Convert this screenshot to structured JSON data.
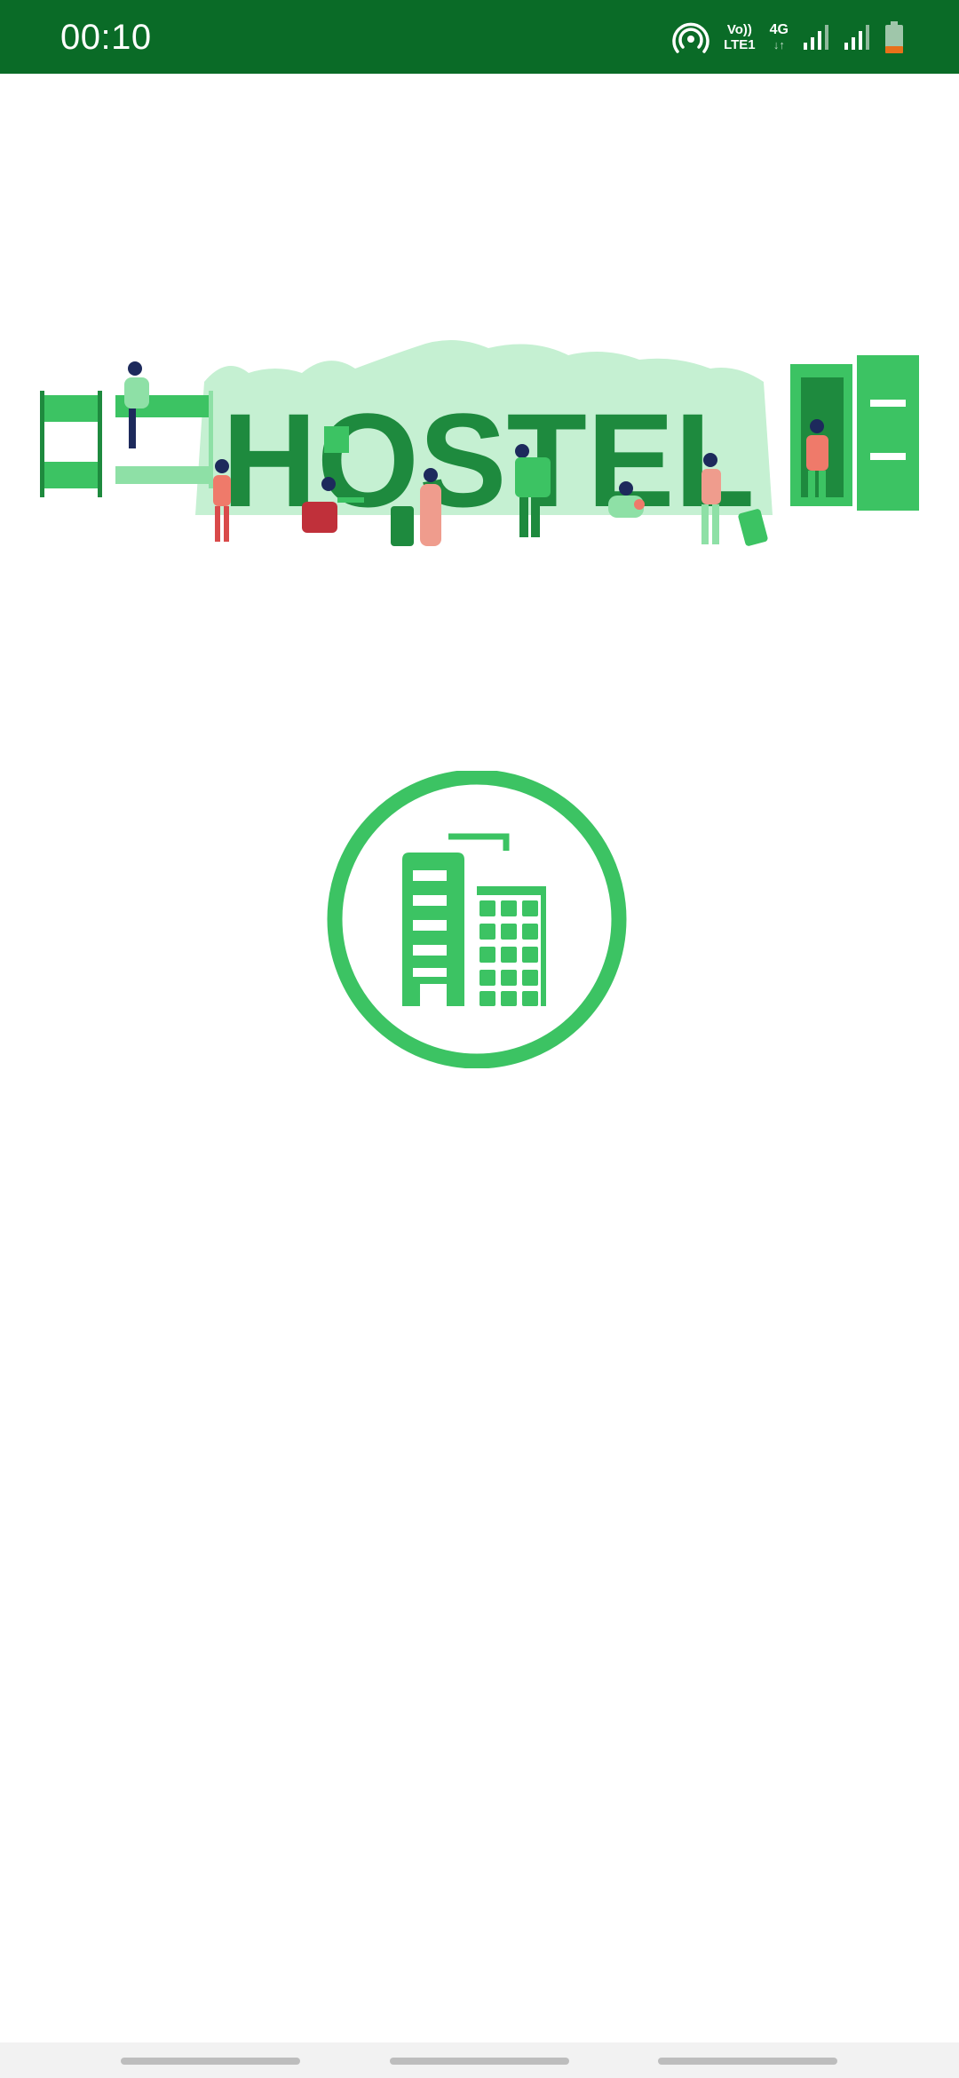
{
  "status_bar": {
    "time": "00:10",
    "icons": [
      "hotspot-icon",
      "volte-icon",
      "4g-icon",
      "signal-icon",
      "signal-icon",
      "battery-icon"
    ],
    "volte_top": "Vo))",
    "volte_bottom": "LTE1",
    "net_type": "4G",
    "net_arrows": "↓↑",
    "battery_level": 0.25,
    "colors": {
      "background": "#0a6b27",
      "battery_low": "#e8711a"
    }
  },
  "banner": {
    "word": "HOSTEL",
    "colors": {
      "dark_green": "#1e8a3e",
      "light_green": "#c5f0d2",
      "accent_green": "#3cc363",
      "skin": "#ef7a6a"
    }
  },
  "logo": {
    "icon": "hostel-building-icon",
    "color": "#3cc363"
  },
  "nav_bar": {
    "items": [
      "nav-pill-left",
      "nav-pill-center",
      "nav-pill-right"
    ]
  }
}
